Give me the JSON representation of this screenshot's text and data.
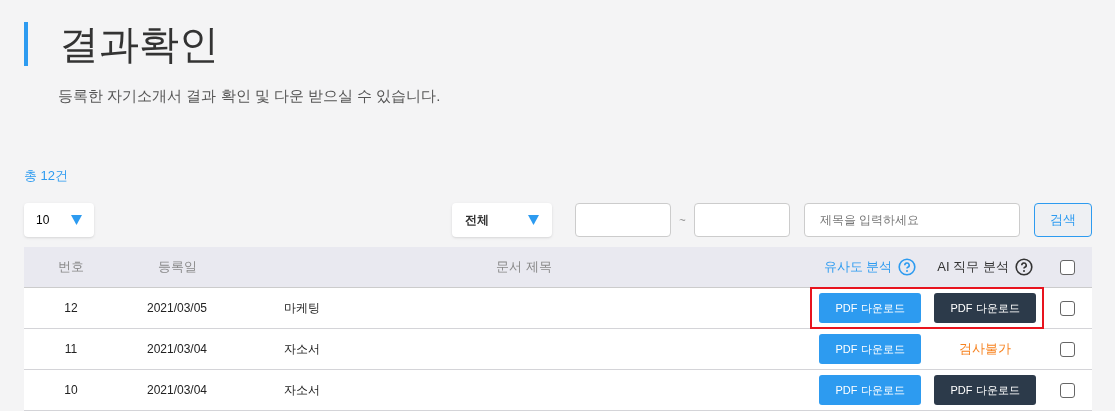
{
  "title": "결과확인",
  "subtitle": "등록한 자기소개서 결과 확인 및 다운 받으실 수 있습니다.",
  "total": "총 12건",
  "filters": {
    "page_size": "10",
    "category": "전체",
    "date_separator": "~",
    "search_placeholder": "제목을 입력하세요",
    "search_button": "검색"
  },
  "table": {
    "columns": [
      {
        "label": "번호",
        "help": false,
        "kind": "plain"
      },
      {
        "label": "등록일",
        "help": false,
        "kind": "plain"
      },
      {
        "label": "문서 제목",
        "help": false,
        "kind": "plain"
      },
      {
        "label": "유사도 분석",
        "help": true,
        "kind": "link"
      },
      {
        "label": "AI 직무 분석",
        "help": true,
        "kind": "plain"
      }
    ],
    "all_checked": false,
    "rows": [
      {
        "number": "12",
        "date": "2021/03/05",
        "title": "마케팅",
        "similarity": {
          "kind": "button",
          "label": "PDF 다운로드"
        },
        "ai": {
          "kind": "button",
          "label": "PDF 다운로드"
        },
        "checked": false,
        "highlighted": true
      },
      {
        "number": "11",
        "date": "2021/03/04",
        "title": "자소서",
        "similarity": {
          "kind": "button",
          "label": "PDF 다운로드"
        },
        "ai": {
          "kind": "unavailable",
          "label": "검사불가"
        },
        "checked": false,
        "highlighted": false
      },
      {
        "number": "10",
        "date": "2021/03/04",
        "title": "자소서",
        "similarity": {
          "kind": "button",
          "label": "PDF 다운로드"
        },
        "ai": {
          "kind": "button",
          "label": "PDF 다운로드"
        },
        "checked": false,
        "highlighted": false
      }
    ]
  }
}
